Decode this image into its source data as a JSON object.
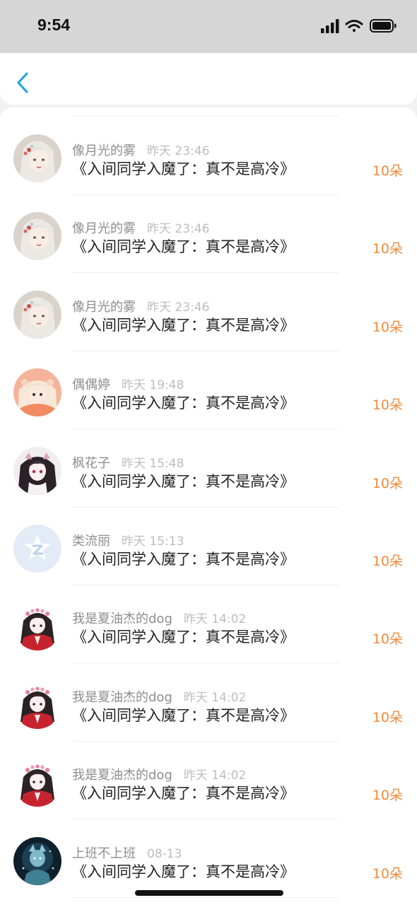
{
  "status_bar": {
    "time": "9:54",
    "icons": [
      "signal-icon",
      "wifi-icon",
      "battery-icon"
    ]
  },
  "nav": {
    "back_icon": "chevron-left-icon",
    "accent_color": "#1aa0e8"
  },
  "colors": {
    "count": "#f08a3c",
    "title": "#222222",
    "meta": "#9a9a9a"
  },
  "gifts": [
    {
      "user": "像月光的雾",
      "time": "昨天 23:46",
      "title": "《入间同学入魔了：真不是高冷》",
      "count": "10朵",
      "avatar": "girl-white-hair"
    },
    {
      "user": "像月光的雾",
      "time": "昨天 23:46",
      "title": "《入间同学入魔了：真不是高冷》",
      "count": "10朵",
      "avatar": "girl-white-hair"
    },
    {
      "user": "像月光的雾",
      "time": "昨天 23:46",
      "title": "《入间同学入魔了：真不是高冷》",
      "count": "10朵",
      "avatar": "girl-white-hair"
    },
    {
      "user": "偶偶婷",
      "time": "昨天 19:48",
      "title": "《入间同学入魔了：真不是高冷》",
      "count": "10朵",
      "avatar": "girl-orange"
    },
    {
      "user": "枫花子",
      "time": "昨天 15:48",
      "title": "《入间同学入魔了：真不是高冷》",
      "count": "10朵",
      "avatar": "girl-pink-dark"
    },
    {
      "user": "类流丽",
      "time": "昨天 15:13",
      "title": "《入间同学入魔了：真不是高冷》",
      "count": "10朵",
      "avatar": "default-qq"
    },
    {
      "user": "我是夏油杰的dog",
      "time": "昨天 14:02",
      "title": "《入间同学入魔了：真不是高冷》",
      "count": "10朵",
      "avatar": "girl-red-kimono"
    },
    {
      "user": "我是夏油杰的dog",
      "time": "昨天 14:02",
      "title": "《入间同学入魔了：真不是高冷》",
      "count": "10朵",
      "avatar": "girl-red-kimono"
    },
    {
      "user": "我是夏油杰的dog",
      "time": "昨天 14:02",
      "title": "《入间同学入魔了：真不是高冷》",
      "count": "10朵",
      "avatar": "girl-red-kimono"
    },
    {
      "user": "上班不上班",
      "time": "08-13",
      "title": "《入间同学入魔了：真不是高冷》",
      "count": "10朵",
      "avatar": "dark-fantasy"
    }
  ]
}
